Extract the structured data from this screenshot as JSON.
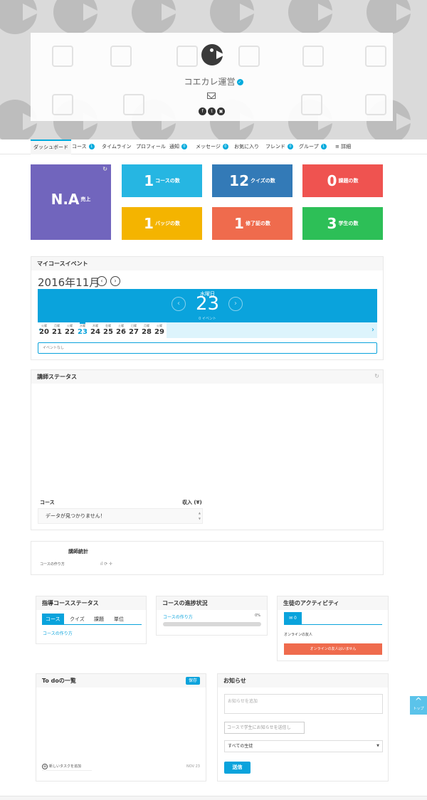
{
  "header": {
    "username": "コエカレ運営",
    "verified_mark": "✓",
    "social": [
      "f",
      "t",
      "▣"
    ]
  },
  "nav": {
    "dashboard": "ダッシュボード",
    "course": "コース",
    "course_count": "1",
    "timeline": "タイムライン",
    "profile": "プロフィール",
    "notifications": "通知",
    "notifications_count": "0",
    "messages": "メッセージ",
    "messages_count": "0",
    "favorites": "お気に入り",
    "friends": "フレンド",
    "friends_count": "0",
    "groups": "グループ",
    "groups_count": "1",
    "more": "≡ 詳細"
  },
  "stats": {
    "sales_value": "N.A",
    "sales_label": "売上",
    "courses_value": "1",
    "courses_label": "コースの数",
    "quizzes_value": "12",
    "quizzes_label": "クイズの数",
    "assignments_value": "0",
    "assignments_label": "課題の数",
    "badges_value": "1",
    "badges_label": "バッジの数",
    "certificates_value": "1",
    "certificates_label": "修了証の数",
    "students_value": "3",
    "students_label": "学生の数",
    "refresh_icon": "↻"
  },
  "calendar": {
    "title": "マイコースイベント",
    "month": "2016年11月",
    "weekday": "水曜日",
    "day": "23",
    "events_label": "イベント",
    "events_count": "0",
    "days": [
      {
        "wd": "火曜",
        "d": "20"
      },
      {
        "wd": "月曜",
        "d": "21"
      },
      {
        "wd": "火曜",
        "d": "22"
      },
      {
        "wd": "水曜",
        "d": "23"
      },
      {
        "wd": "木曜",
        "d": "24"
      },
      {
        "wd": "金曜",
        "d": "25"
      },
      {
        "wd": "土曜",
        "d": "26"
      },
      {
        "wd": "日曜",
        "d": "27"
      },
      {
        "wd": "月曜",
        "d": "28"
      },
      {
        "wd": "火曜",
        "d": "29"
      }
    ],
    "no_event": "イベントなし"
  },
  "instructor_status": {
    "title": "講師ステータス",
    "col_course": "コース",
    "col_income": "収入 (¥)",
    "empty": "データが見つかりません！"
  },
  "instructor_stats": {
    "title": "講師統計",
    "course_name": "コースの作り方",
    "sparkline": "ıl ⟳ ✛"
  },
  "course_status": {
    "title": "指導コースステータス",
    "tabs": [
      "コース",
      "クイズ",
      "課題",
      "単位"
    ],
    "course_link": "コースの作り方"
  },
  "progress_panel": {
    "title": "コースの進捗状況",
    "course_link": "コースの作り方",
    "percent": "0%",
    "progress": 0
  },
  "activity": {
    "title": "生徒のアクティビティ",
    "tab_count": "0",
    "online_label": "オンラインの友人",
    "no_online": "オンラインの友人はいません"
  },
  "todo": {
    "title": "To doの一覧",
    "save": "保存",
    "add_task": "新しいタスクを追加",
    "date": "NOV 23"
  },
  "notice": {
    "title": "お知らせ",
    "textarea_placeholder": "お知らせを追加",
    "input_placeholder": "コースで学生にお知らせを送信し",
    "select_value": "すべての生徒",
    "send": "送信"
  },
  "top_button": "トップ",
  "colors": {
    "accent": "#0aa3dc",
    "sales": "#7165bd",
    "courses": "#26b6e2",
    "quizzes": "#337ab7",
    "assignments": "#ef5350",
    "badges": "#f4b400",
    "certificates": "#ef6b4d",
    "students": "#2dbf57"
  }
}
